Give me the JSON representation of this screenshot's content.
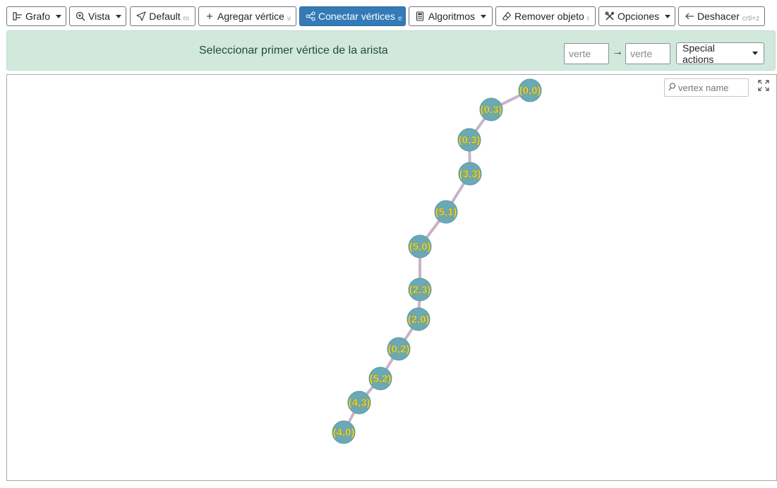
{
  "toolbar": {
    "grafo": "Grafo",
    "vista": "Vista",
    "default": "Default",
    "default_key": "m",
    "add_vertex": "Agregar vértice",
    "add_vertex_key": "v",
    "connect": "Conectar vértices",
    "connect_key": "e",
    "algorithms": "Algoritmos",
    "remove": "Remover objeto",
    "remove_key": "r",
    "options": "Opciones",
    "undo": "Deshacer",
    "undo_key": "crtl+z"
  },
  "alert": {
    "message": "Seleccionar primer vértice de la arista",
    "from_placeholder": "verte",
    "to_placeholder": "verte",
    "arrow": "→",
    "special_actions": "Special actions"
  },
  "canvas": {
    "search_placeholder": "vertex name",
    "vertices": [
      "(0,0)",
      "(0,3)",
      "(0,3)",
      "(3,3)",
      "(5,1)",
      "(5,0)",
      "(2,3)",
      "(2,0)",
      "(0,2)",
      "(5,2)",
      "(4,3)",
      "(4,0)"
    ],
    "edges": [
      [
        0,
        1
      ],
      [
        1,
        2
      ],
      [
        2,
        3
      ],
      [
        3,
        4
      ],
      [
        4,
        5
      ],
      [
        5,
        6
      ],
      [
        6,
        7
      ],
      [
        7,
        8
      ],
      [
        8,
        9
      ],
      [
        9,
        10
      ],
      [
        10,
        11
      ]
    ]
  },
  "colors": {
    "accent": "#337ab7",
    "alert_bg": "#d2e8dd",
    "vertex_fill": "#6aa9b5",
    "vertex_label": "#f0dc3c",
    "edge": "#c9b3c9"
  }
}
